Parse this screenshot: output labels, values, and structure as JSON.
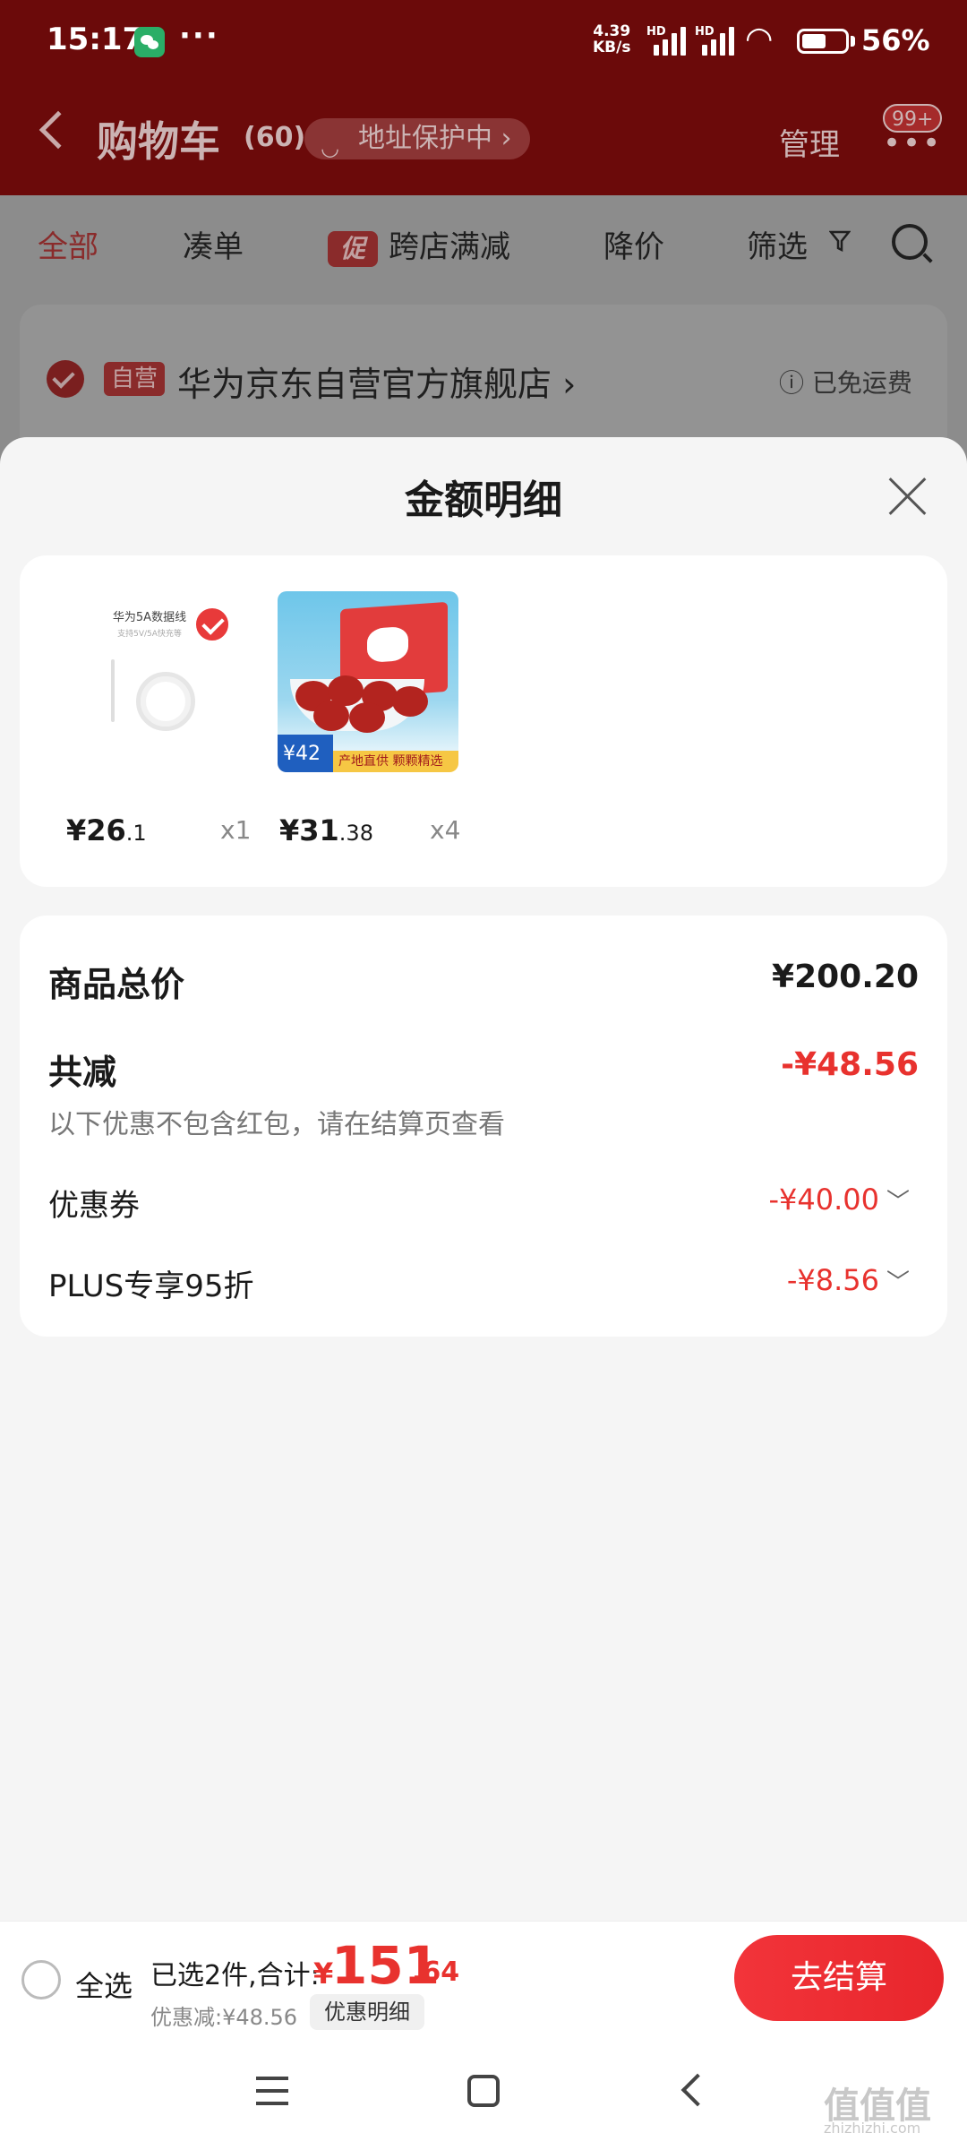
{
  "status_bar": {
    "time": "15:17",
    "more": "···",
    "net_speed_value": "4.39",
    "net_speed_unit": "KB/s",
    "hd_1": "HD",
    "hd_2": "HD",
    "battery_percent": "56%",
    "battery_level": 0.56
  },
  "header": {
    "title": "购物车",
    "count": "(60)",
    "address_protect": "地址保护中",
    "manage": "管理",
    "badge": "99+"
  },
  "tabs": [
    {
      "label": "全部"
    },
    {
      "label": "凑单"
    },
    {
      "label": "跨店满减",
      "badge": "促"
    },
    {
      "label": "降价"
    },
    {
      "label": "筛选"
    }
  ],
  "store": {
    "tag": "自营",
    "name": "华为京东自营官方旗舰店",
    "shipping": "已免运费"
  },
  "sheet": {
    "title": "金额明细",
    "products": [
      {
        "caption": "华为5A数据线",
        "sub": "支持5V/5A快充等",
        "price_int": "¥26",
        "price_dec": ".1",
        "qty": "x1"
      },
      {
        "image_price": "42",
        "band": "产地直供 颗颗精选",
        "price_int": "¥31",
        "price_dec": ".38",
        "qty": "x4"
      }
    ],
    "total_label": "商品总价",
    "total_value": "¥200.20",
    "reduce_label": "共减",
    "reduce_value": "-¥48.56",
    "note": "以下优惠不包含红包，请在结算页查看",
    "coupon_label": "优惠券",
    "coupon_value": "-¥40.00",
    "plus_label": "PLUS专享95折",
    "plus_value": "-¥8.56"
  },
  "checkout": {
    "select_all": "全选",
    "summary": "已选2件,合计:",
    "yen": "¥",
    "amount_int": "151",
    "amount_dec": ".64",
    "saved": "优惠减:¥48.56",
    "detail": "优惠明细",
    "submit": "去结算"
  },
  "watermark": {
    "text": "值值值",
    "domain": "zhizhizhi.com"
  },
  "colors": {
    "accent": "#e8322e",
    "header_dim": "#6b0a0a",
    "button": "#f2343a"
  }
}
